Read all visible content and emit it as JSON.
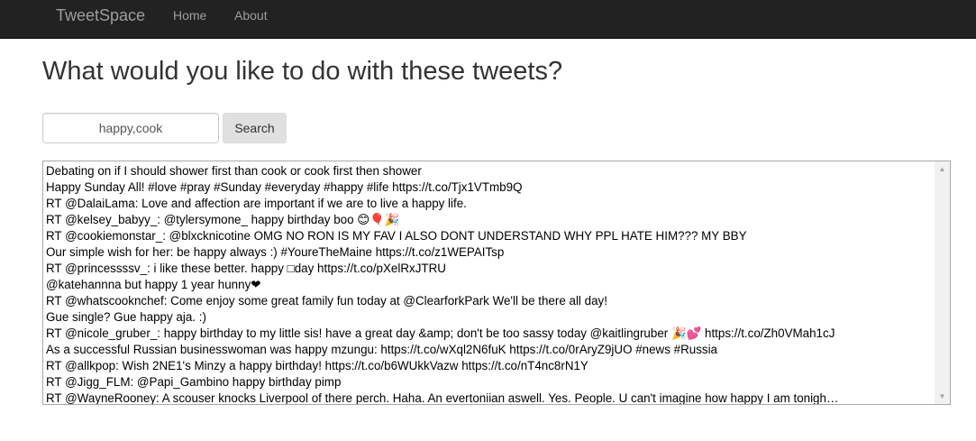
{
  "navbar": {
    "brand": "TweetSpace",
    "links": [
      "Home",
      "About"
    ]
  },
  "page": {
    "title": "What would you like to do with these tweets?"
  },
  "search": {
    "value": "happy,cook",
    "button_label": "Search"
  },
  "results": {
    "tweets": [
      "Debating on if I should shower first than cook or cook first then shower",
      "Happy Sunday All! #love #pray #Sunday #everyday #happy #life https://t.co/Tjx1VTmb9Q",
      "RT @DalaiLama: Love and affection are important if we are to live a happy life.",
      "RT @kelsey_babyy_: @tylersymone_ happy birthday boo 😊🎈🎉",
      "RT @cookiemonstar_: @blxcknicotine OMG NO RON IS MY FAV I ALSO DONT UNDERSTAND WHY PPL HATE HIM??? MY BBY",
      "Our simple wish for her: be happy always :) #YoureTheMaine https://t.co/z1WEPAITsp",
      "RT @princessssv_: i like these better. happy □day https://t.co/pXelRxJTRU",
      "@katehannna but happy 1 year hunny❤",
      "RT @whatscooknchef: Come enjoy some great family fun today at @ClearforkPark We'll be there all day!",
      "Gue single? Gue happy aja. :)",
      "RT @nicole_gruber_: happy birthday to my little sis! have a great day &amp; don't be too sassy today @kaitlingruber 🎉💕 https://t.co/Zh0VMah1cJ",
      "As a successful Russian businesswoman was happy mzungu: https://t.co/wXql2N6fuK https://t.co/0rAryZ9jUO #news #Russia",
      "RT @allkpop: Wish 2NE1's Minzy a happy birthday! https://t.co/b6WUkkVazw https://t.co/nT4nc8rN1Y",
      "RT @Jigg_FLM: @Papi_Gambino happy birthday pimp",
      "RT @WayneRooney: A scouser knocks Liverpool of there perch. Haha. An evertoniian aswell. Yes. People. U can't imagine how happy I am tonigh…"
    ]
  },
  "colors": {
    "navbar_bg": "#222222",
    "nav_text": "#9d9d9d",
    "button_bg": "#e0e0e0"
  },
  "icons": {
    "scroll_up": "scroll-up-arrow-icon",
    "scroll_down": "scroll-down-arrow-icon"
  }
}
